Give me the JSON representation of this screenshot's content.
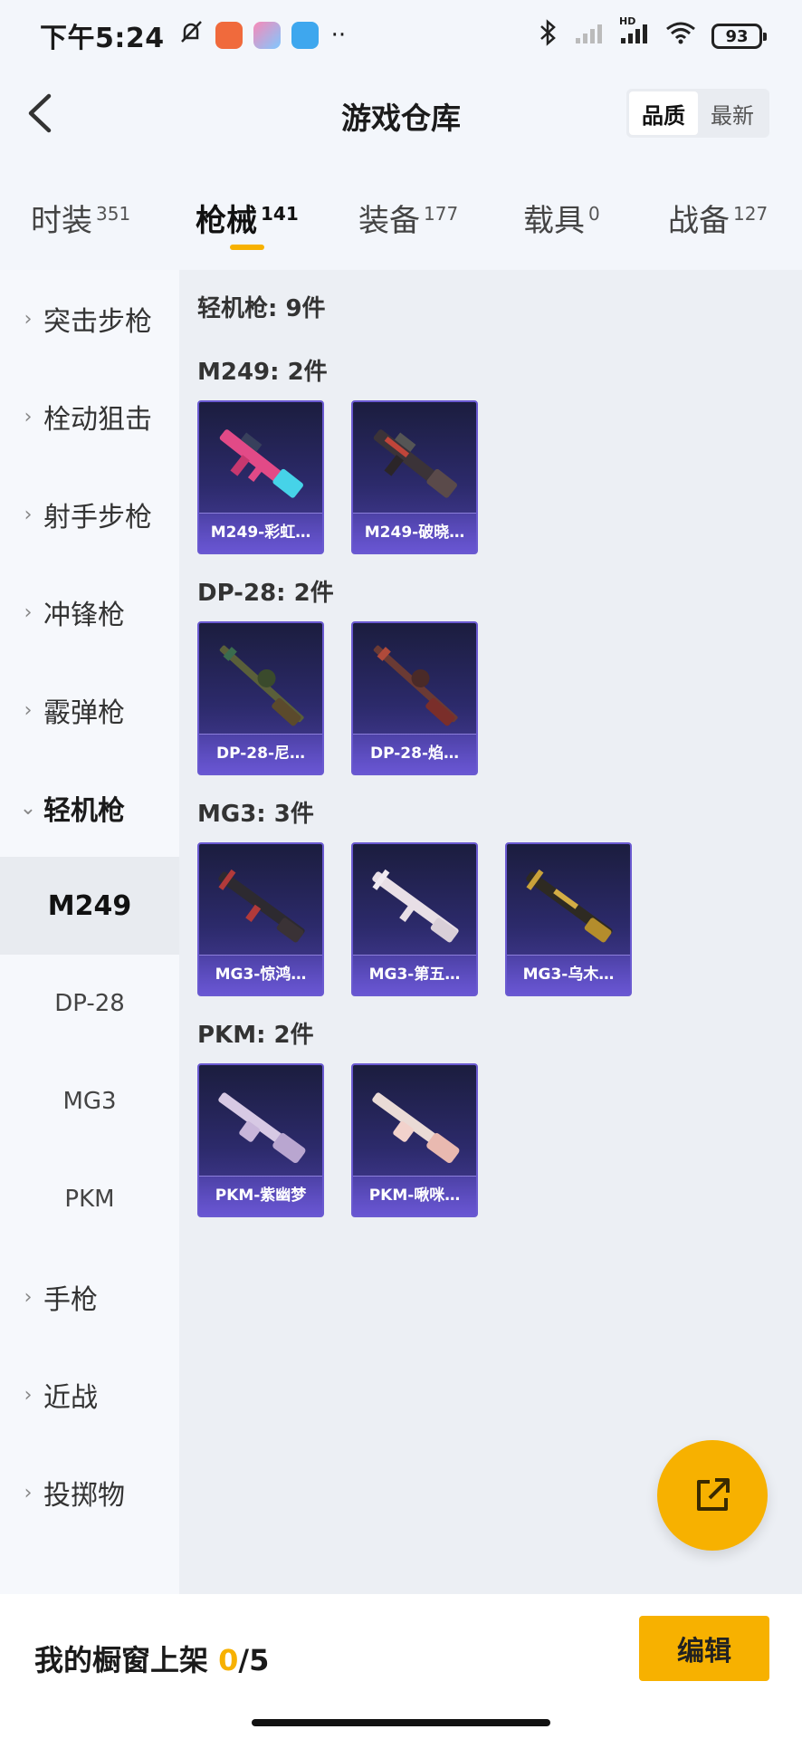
{
  "status_bar": {
    "time": "下午5:24",
    "battery": "93",
    "network": "HD"
  },
  "header": {
    "title": "游戏仓库",
    "sort_options": [
      "品质",
      "最新"
    ],
    "sort_active": "品质"
  },
  "tabs": [
    {
      "label": "时装",
      "count": "351"
    },
    {
      "label": "枪械",
      "count": "141"
    },
    {
      "label": "装备",
      "count": "177"
    },
    {
      "label": "载具",
      "count": "0"
    },
    {
      "label": "战备",
      "count": "127"
    }
  ],
  "active_tab": "枪械",
  "sidebar": {
    "categories": [
      "突击步枪",
      "栓动狙击",
      "射手步枪",
      "冲锋枪",
      "霰弹枪",
      "轻机枪"
    ],
    "subcategories": [
      "M249",
      "DP-28",
      "MG3",
      "PKM"
    ],
    "active_sub": "M249",
    "categories_after": [
      "手枪",
      "近战",
      "投掷物"
    ]
  },
  "main": {
    "total_label": "轻机枪: 9件",
    "groups": [
      {
        "title": "M249: 2件",
        "items": [
          "M249-彩虹…",
          "M249-破晓…"
        ]
      },
      {
        "title": "DP-28: 2件",
        "items": [
          "DP-28-尼…",
          "DP-28-焰…"
        ]
      },
      {
        "title": "MG3: 3件",
        "items": [
          "MG3-惊鸿…",
          "MG3-第五…",
          "MG3-乌木…"
        ]
      },
      {
        "title": "PKM: 2件",
        "items": [
          "PKM-紫幽梦",
          "PKM-啾咪…"
        ]
      }
    ]
  },
  "bottom_bar": {
    "shelf_label": "我的橱窗上架 ",
    "shelf_current": "0",
    "shelf_total": "/5",
    "edit_label": "编辑"
  },
  "colors": {
    "accent": "#f7b100",
    "card_top": "#1b1d3e",
    "card_bottom": "#4a3fa0"
  },
  "icons": {
    "back": "chevron-left-icon",
    "fab": "share-external-icon"
  }
}
